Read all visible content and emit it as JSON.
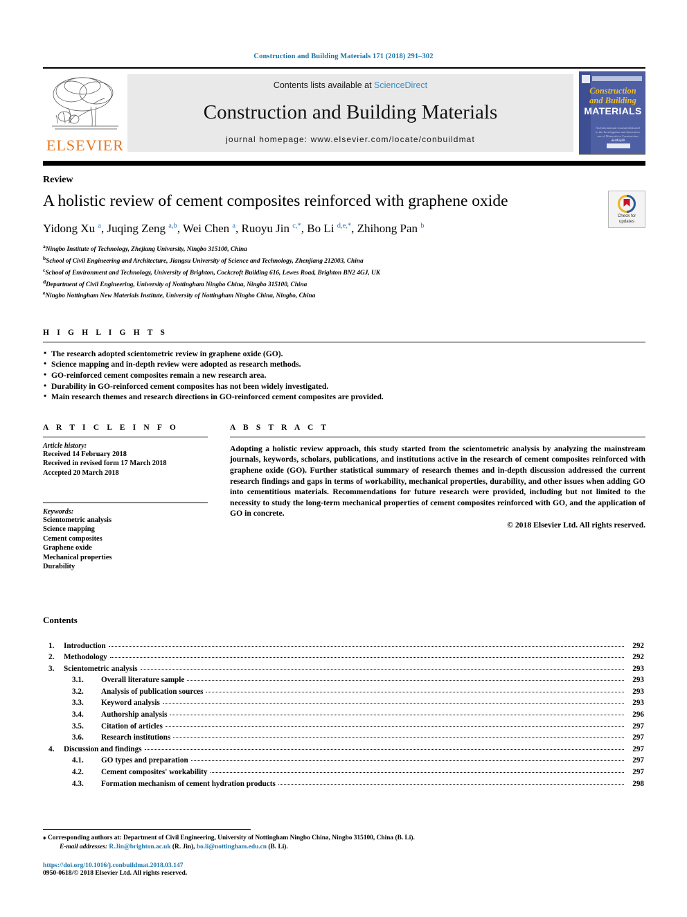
{
  "running_head": "Construction and Building Materials 171 (2018) 291–302",
  "masthead": {
    "publisher_name": "ELSEVIER",
    "publisher_logo_icon": "elsevier-tree-icon",
    "contents_prefix": "Contents lists available at",
    "contents_link": "ScienceDirect",
    "journal_name": "Construction and Building Materials",
    "homepage_line": "journal homepage: www.elsevier.com/locate/conbuildmat",
    "cover": {
      "line1": "Construction",
      "line2": "and Building",
      "line3": "MATERIALS",
      "subtitle": "An International Journal dedicated to the Investigation and Innovative use of Materials in Construction and Repair",
      "footer_line": "ELSEVIER"
    },
    "link_color": "#3b8dc4",
    "brand_color": "#E87722"
  },
  "article": {
    "doctype": "Review",
    "title": "A holistic review of cement composites reinforced with graphene oxide",
    "authors_html": "Yidong Xu <sup>a</sup>, Juqing Zeng <sup>a,b</sup>, Wei Chen <sup>a</sup>, Ruoyu Jin <sup>c,*</sup>, Bo Li <sup>d,e,*</sup>, Zhihong Pan <sup>b</sup>",
    "crossmark": {
      "line1": "Check for",
      "line2": "updates"
    },
    "affiliations": [
      {
        "mark": "a",
        "text": "Ningbo Institute of Technology, Zhejiang University, Ningbo 315100, China"
      },
      {
        "mark": "b",
        "text": "School of Civil Engineering and Architecture, Jiangsu University of Science and Technology, Zhenjiang 212003, China"
      },
      {
        "mark": "c",
        "text": "School of Environment and Technology, University of Brighton, Cockcroft Building 616, Lewes Road, Brighton BN2 4GJ, UK"
      },
      {
        "mark": "d",
        "text": "Department of Civil Engineering, University of Nottingham Ningbo China, Ningbo 315100, China"
      },
      {
        "mark": "e",
        "text": "Ningbo Nottingham New Materials Institute, University of Nottingham Ningbo China, Ningbo, China"
      }
    ]
  },
  "highlights": {
    "heading": "H I G H L I G H T S",
    "items": [
      "The research adopted scientometric review in graphene oxide (GO).",
      "Science mapping and in-depth review were adopted as research methods.",
      "GO-reinforced cement composites remain a new research area.",
      "Durability in GO-reinforced cement composites has not been widely investigated.",
      "Main research themes and research directions in GO-reinforced cement composites are provided."
    ]
  },
  "article_info": {
    "heading": "A R T I C L E  I N F O",
    "history_label": "Article history:",
    "history": [
      "Received 14 February 2018",
      "Received in revised form 17 March 2018",
      "Accepted 20 March 2018"
    ],
    "keywords_label": "Keywords:",
    "keywords": [
      "Scientometric analysis",
      "Science mapping",
      "Cement composites",
      "Graphene oxide",
      "Mechanical properties",
      "Durability"
    ]
  },
  "abstract": {
    "heading": "A B S T R A C T",
    "text": "Adopting a holistic review approach, this study started from the scientometric analysis by analyzing the mainstream journals, keywords, scholars, publications, and institutions active in the research of cement composites reinforced with graphene oxide (GO). Further statistical summary of research themes and in-depth discussion addressed the current research findings and gaps in terms of workability, mechanical properties, durability, and other issues when adding GO into cementitious materials. Recommendations for future research were provided, including but not limited to the necessity to study the long-term mechanical properties of cement composites reinforced with GO, and the application of GO in concrete.",
    "copyright": "© 2018 Elsevier Ltd. All rights reserved."
  },
  "contents": {
    "title": "Contents",
    "entries": [
      {
        "level": 1,
        "num": "1.",
        "label": "Introduction",
        "page": "292"
      },
      {
        "level": 1,
        "num": "2.",
        "label": "Methodology",
        "page": "292"
      },
      {
        "level": 1,
        "num": "3.",
        "label": "Scientometric analysis",
        "page": "293"
      },
      {
        "level": 2,
        "num": "3.1.",
        "label": "Overall literature sample",
        "page": "293"
      },
      {
        "level": 2,
        "num": "3.2.",
        "label": "Analysis of publication sources",
        "page": "293"
      },
      {
        "level": 2,
        "num": "3.3.",
        "label": "Keyword analysis",
        "page": "293"
      },
      {
        "level": 2,
        "num": "3.4.",
        "label": "Authorship analysis",
        "page": "296"
      },
      {
        "level": 2,
        "num": "3.5.",
        "label": "Citation of articles",
        "page": "297"
      },
      {
        "level": 2,
        "num": "3.6.",
        "label": "Research institutions",
        "page": "297"
      },
      {
        "level": 1,
        "num": "4.",
        "label": "Discussion and findings",
        "page": "297"
      },
      {
        "level": 2,
        "num": "4.1.",
        "label": "GO types and preparation",
        "page": "297"
      },
      {
        "level": 2,
        "num": "4.2.",
        "label": "Cement composites' workability",
        "page": "297"
      },
      {
        "level": 2,
        "num": "4.3.",
        "label": "Formation mechanism of cement hydration products",
        "page": "298"
      }
    ]
  },
  "footer": {
    "corresponding_mark": "⁎",
    "corresponding_note": "Corresponding authors at: Department of Civil Engineering, University of Nottingham Ningbo China, Ningbo 315100, China (B. Li).",
    "email_label": "E-mail addresses:",
    "email1": "R.Jin@brighton.ac.uk",
    "email1_who": "(R. Jin),",
    "email2": "bo.li@nottingham.edu.cn",
    "email2_who": "(B. Li).",
    "doi": "https://doi.org/10.1016/j.conbuildmat.2018.03.147",
    "issn": "0950-0618/© 2018 Elsevier Ltd. All rights reserved."
  }
}
